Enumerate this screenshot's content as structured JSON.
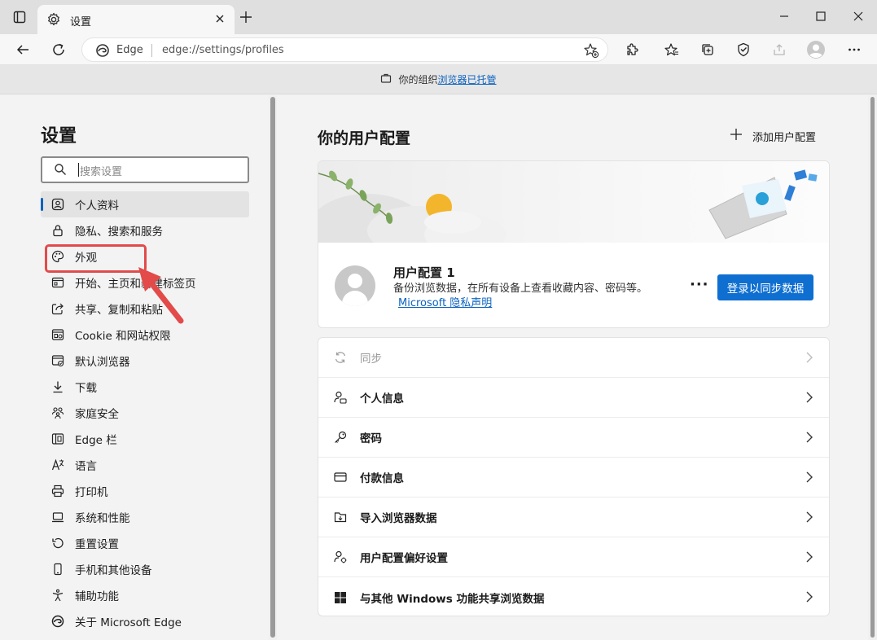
{
  "tab": {
    "title": "设置"
  },
  "address": {
    "site_name": "Edge",
    "url": "edge://settings/profiles"
  },
  "managed_banner": {
    "prefix": "你的组织",
    "link": "浏览器已托管"
  },
  "sidebar": {
    "title": "设置",
    "search_placeholder": "搜索设置",
    "items": [
      {
        "label": "个人资料",
        "icon": "profile-icon"
      },
      {
        "label": "隐私、搜索和服务",
        "icon": "lock-icon"
      },
      {
        "label": "外观",
        "icon": "palette-icon"
      },
      {
        "label": "开始、主页和新建标签页",
        "icon": "home-page-icon"
      },
      {
        "label": "共享、复制和粘贴",
        "icon": "share-icon"
      },
      {
        "label": "Cookie 和网站权限",
        "icon": "site-permissions-icon"
      },
      {
        "label": "默认浏览器",
        "icon": "default-browser-icon"
      },
      {
        "label": "下载",
        "icon": "download-icon"
      },
      {
        "label": "家庭安全",
        "icon": "family-icon"
      },
      {
        "label": "Edge 栏",
        "icon": "edge-bar-icon"
      },
      {
        "label": "语言",
        "icon": "language-icon"
      },
      {
        "label": "打印机",
        "icon": "printer-icon"
      },
      {
        "label": "系统和性能",
        "icon": "system-icon"
      },
      {
        "label": "重置设置",
        "icon": "reset-icon"
      },
      {
        "label": "手机和其他设备",
        "icon": "phone-icon"
      },
      {
        "label": "辅助功能",
        "icon": "accessibility-icon"
      },
      {
        "label": "关于 Microsoft Edge",
        "icon": "edge-logo-icon"
      }
    ]
  },
  "main": {
    "title": "你的用户配置",
    "add_profile": "添加用户配置",
    "profile": {
      "name": "用户配置 1",
      "description": "备份浏览数据，在所有设备上查看收藏内容、密码等。",
      "privacy_link": "Microsoft 隐私声明",
      "more": "···",
      "signin_button": "登录以同步数据"
    },
    "rows": [
      {
        "label": "同步",
        "icon": "sync-icon"
      },
      {
        "label": "个人信息",
        "icon": "personal-info-icon"
      },
      {
        "label": "密码",
        "icon": "key-icon"
      },
      {
        "label": "付款信息",
        "icon": "card-icon"
      },
      {
        "label": "导入浏览器数据",
        "icon": "import-icon"
      },
      {
        "label": "用户配置偏好设置",
        "icon": "profile-preferences-icon"
      },
      {
        "label": "与其他 Windows 功能共享浏览数据",
        "icon": "windows-icon"
      }
    ]
  },
  "colors": {
    "accent": "#0e6fd1",
    "highlight": "#e34a4a"
  }
}
